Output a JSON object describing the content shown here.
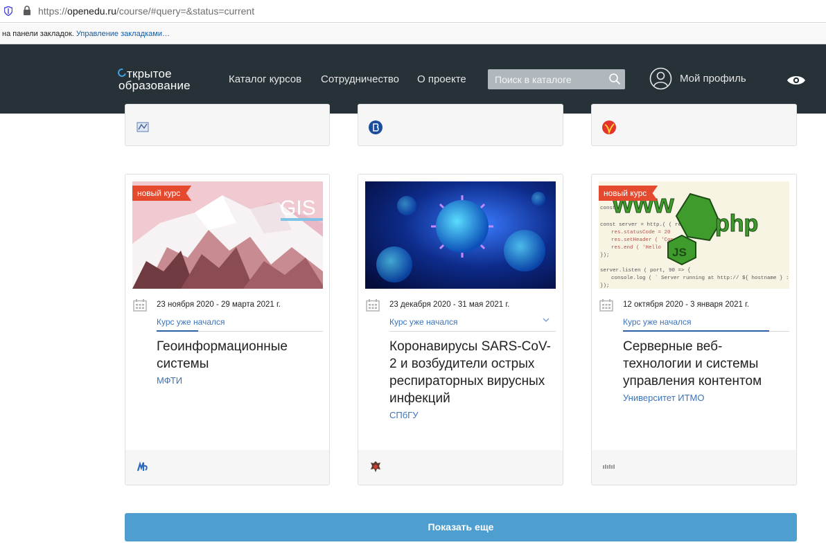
{
  "browser": {
    "url_prefix": "https://",
    "url_host": "openedu.ru",
    "url_path": "/course/#query=&status=current",
    "bookmarks_text": "на панели закладок.",
    "bookmarks_link": "Управление закладками…"
  },
  "header": {
    "logo_line1": "ткрытое",
    "logo_line2": "образование",
    "nav": [
      "Каталог курсов",
      "Сотрудничество",
      "О проекте"
    ],
    "search_placeholder": "Поиск в каталоге",
    "profile": "Мой профиль"
  },
  "courses": [
    {
      "badge": "новый курс",
      "image_caption": "GIS",
      "dates": "23 ноября 2020 - 29 марта 2021 г.",
      "status": "Курс уже начался",
      "title": "Геоинформационные системы",
      "org": "МФТИ"
    },
    {
      "badge": "",
      "dates": "23 декабря 2020 - 31 мая 2021 г.",
      "status": "Курс уже начался",
      "title": "Коронавирусы SARS-CoV-2 и возбудители острых респираторных вирусных инфекций",
      "org": "СПбГУ"
    },
    {
      "badge": "новый курс",
      "image_caption": "php",
      "dates": "12 октября 2020 - 3 января 2021 г.",
      "status": "Курс уже начался",
      "title": "Серверные веб-технологии и системы управления контентом",
      "org": "Университет ИТМО"
    }
  ],
  "show_more": "Показать еще",
  "colors": {
    "header_bg": "#263238",
    "link": "#3b73b9",
    "badge": "#e64a2e",
    "button": "#4e9fd0"
  }
}
